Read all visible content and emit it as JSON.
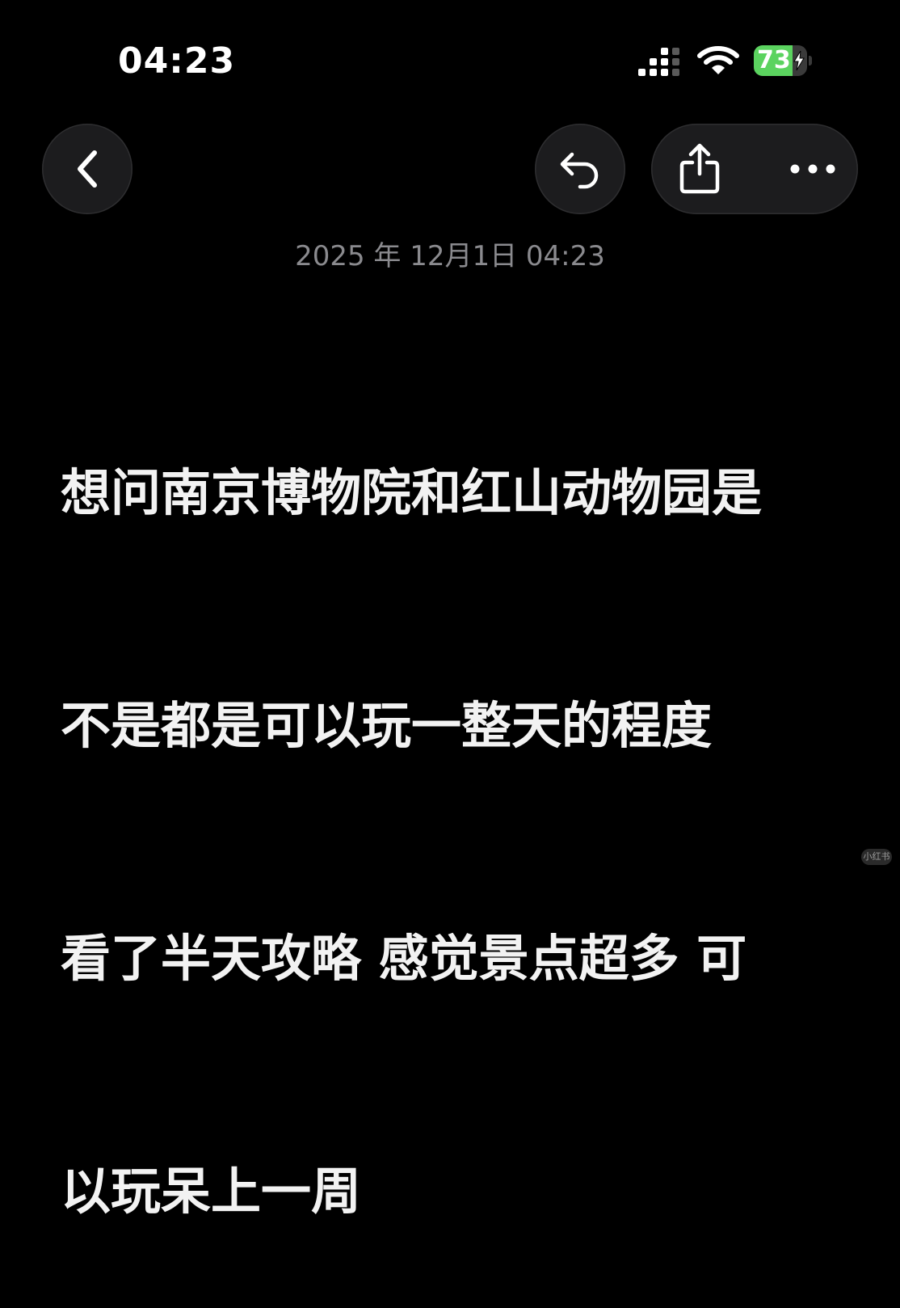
{
  "status_bar": {
    "time": "04:23",
    "battery_percent": "73",
    "battery_level": 0.73,
    "icons": [
      "cellular-signal-icon",
      "wifi-icon",
      "battery-icon",
      "charging-bolt-icon"
    ]
  },
  "toolbar": {
    "icons": [
      "chevron-left-icon",
      "undo-icon",
      "share-icon",
      "more-icon"
    ]
  },
  "note": {
    "date": "2025 年 12月1日 04:23",
    "lines": [
      "想问南京博物院和红山动物园是",
      "不是都是可以玩一整天的程度",
      "看了半天攻略 感觉景点超多 可",
      "以玩呆上一周"
    ]
  },
  "watermark": {
    "text": "小红书"
  },
  "colors": {
    "background": "#000000",
    "button_bg": "#1c1c1e",
    "date_text": "#8a8a8e",
    "battery_green": "#5bd35f"
  }
}
